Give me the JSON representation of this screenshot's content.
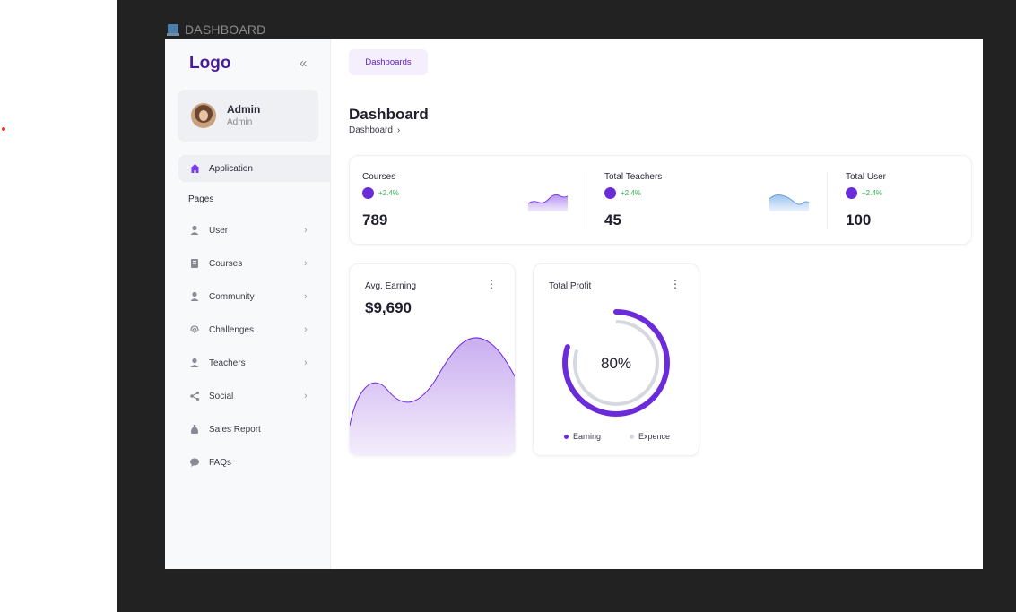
{
  "window_title": "DASHBOARD",
  "sidebar": {
    "logo": "Logo",
    "collapse_icon": "chevrons-left-icon",
    "profile": {
      "name": "Admin",
      "role": "Admin"
    },
    "active_item": {
      "label": "Application",
      "icon": "home-icon"
    },
    "section_label": "Pages",
    "items": [
      {
        "label": "User",
        "icon": "user-icon",
        "has_chevron": true
      },
      {
        "label": "Courses",
        "icon": "book-icon",
        "has_chevron": true
      },
      {
        "label": "Community",
        "icon": "user-icon",
        "has_chevron": true
      },
      {
        "label": "Challenges",
        "icon": "fingerprint-icon",
        "has_chevron": true
      },
      {
        "label": "Teachers",
        "icon": "user-icon",
        "has_chevron": true
      },
      {
        "label": "Social",
        "icon": "share-icon",
        "has_chevron": true
      },
      {
        "label": "Sales Report",
        "icon": "money-bag-icon",
        "has_chevron": false
      },
      {
        "label": "FAQs",
        "icon": "chat-icon",
        "has_chevron": false
      }
    ]
  },
  "main": {
    "tab_pill": "Dashboards",
    "title": "Dashboard",
    "breadcrumb": "Dashboard",
    "stats": [
      {
        "label": "Courses",
        "change": "+2.4%",
        "value": "789"
      },
      {
        "label": "Total Teachers",
        "change": "+2.4%",
        "value": "45"
      },
      {
        "label": "Total User",
        "change": "+2.4%",
        "value": "100"
      }
    ],
    "avg_earning": {
      "title": "Avg. Earning",
      "value": "$9,690"
    },
    "total_profit": {
      "title": "Total Profit",
      "center_label": "80%",
      "percent": 80,
      "legend": [
        "Earning",
        "Expence"
      ]
    }
  },
  "colors": {
    "brand": "#4a1d96",
    "accent": "#6c2bd9",
    "positive": "#2fb14f",
    "sparkline_blue": "#8fb8ea",
    "ring_gray": "#d5d8de"
  }
}
